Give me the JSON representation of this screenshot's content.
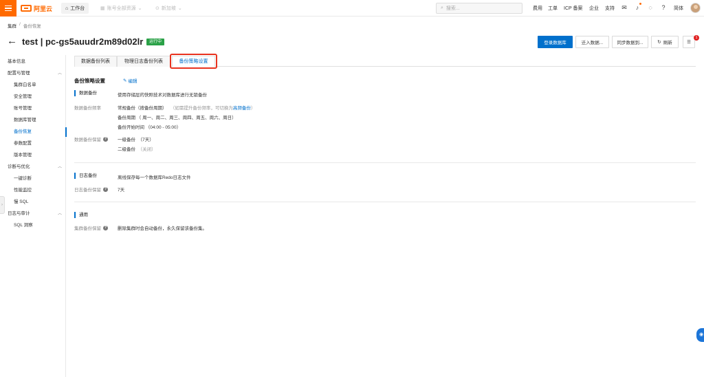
{
  "topbar": {
    "logo_text": "阿里云",
    "workbench": "工作台",
    "account_resources": "账号全部资源",
    "region": "新加坡",
    "search_placeholder": "搜索...",
    "links": [
      "费用",
      "工单",
      "ICP 备案",
      "企业",
      "支持"
    ],
    "language": "简体",
    "accent_color": "#ff6a00"
  },
  "breadcrumb": [
    "集群",
    "/",
    "备份恢复"
  ],
  "header": {
    "title": "test | pc-gs5auudr2m89d02lr",
    "status": "运行中",
    "buttons": {
      "login_db": "登录数据库",
      "migrate_in": "迁入数据...",
      "sync_data": "同步数据到...",
      "refresh": "刷新"
    },
    "notification_count": "1"
  },
  "sidebar": {
    "items": [
      {
        "label": "基本信息",
        "type": "group"
      },
      {
        "label": "配置与管理",
        "type": "group",
        "expanded": true
      },
      {
        "label": "集群白名单",
        "type": "child"
      },
      {
        "label": "安全管理",
        "type": "child"
      },
      {
        "label": "账号管理",
        "type": "child"
      },
      {
        "label": "数据库管理",
        "type": "child"
      },
      {
        "label": "备份恢复",
        "type": "child",
        "active": true
      },
      {
        "label": "参数配置",
        "type": "child"
      },
      {
        "label": "版本管理",
        "type": "child"
      },
      {
        "label": "诊断与优化",
        "type": "group",
        "expanded": true
      },
      {
        "label": "一键诊断",
        "type": "child"
      },
      {
        "label": "性能监控",
        "type": "child"
      },
      {
        "label": "慢 SQL",
        "type": "child"
      },
      {
        "label": "日志与审计",
        "type": "group",
        "expanded": true
      },
      {
        "label": "SQL 洞察",
        "type": "child"
      }
    ]
  },
  "tabs": [
    {
      "label": "数据备份列表",
      "active": false
    },
    {
      "label": "物理日志备份列表",
      "active": false
    },
    {
      "label": "备份策略设置",
      "active": true
    }
  ],
  "policy": {
    "title": "备份策略设置",
    "edit": "编辑",
    "data_backup": {
      "heading": "数据备份",
      "description": "使用存储层的快照技术对数据库进行无锁备份",
      "freq_label": "数据备份频率",
      "freq_value": "常规备份（按备份周期）",
      "freq_hint_prefix": "（如需提升备份频率，可切换为",
      "freq_hint_link": "高频备份",
      "freq_hint_suffix": "）",
      "cycle": "备份周期 （ 周一、周二、周三、周四、周五、周六、周日）",
      "start_time": "备份开始时间 （04:00 - 05:00）",
      "retention_label": "数据备份保留",
      "level1": "一级备份",
      "level1_value": "（7天）",
      "level2": "二级备份",
      "level2_value": "（关闭）"
    },
    "log_backup": {
      "heading": "日志备份",
      "description": "离线保存每一个数据库Redo日志文件",
      "retention_label": "日志备份保留",
      "retention_value": "7天"
    },
    "general": {
      "heading": "通用",
      "label": "集群备份保留",
      "value": "删除集群时会自动备份，永久保留该备份集。"
    }
  }
}
